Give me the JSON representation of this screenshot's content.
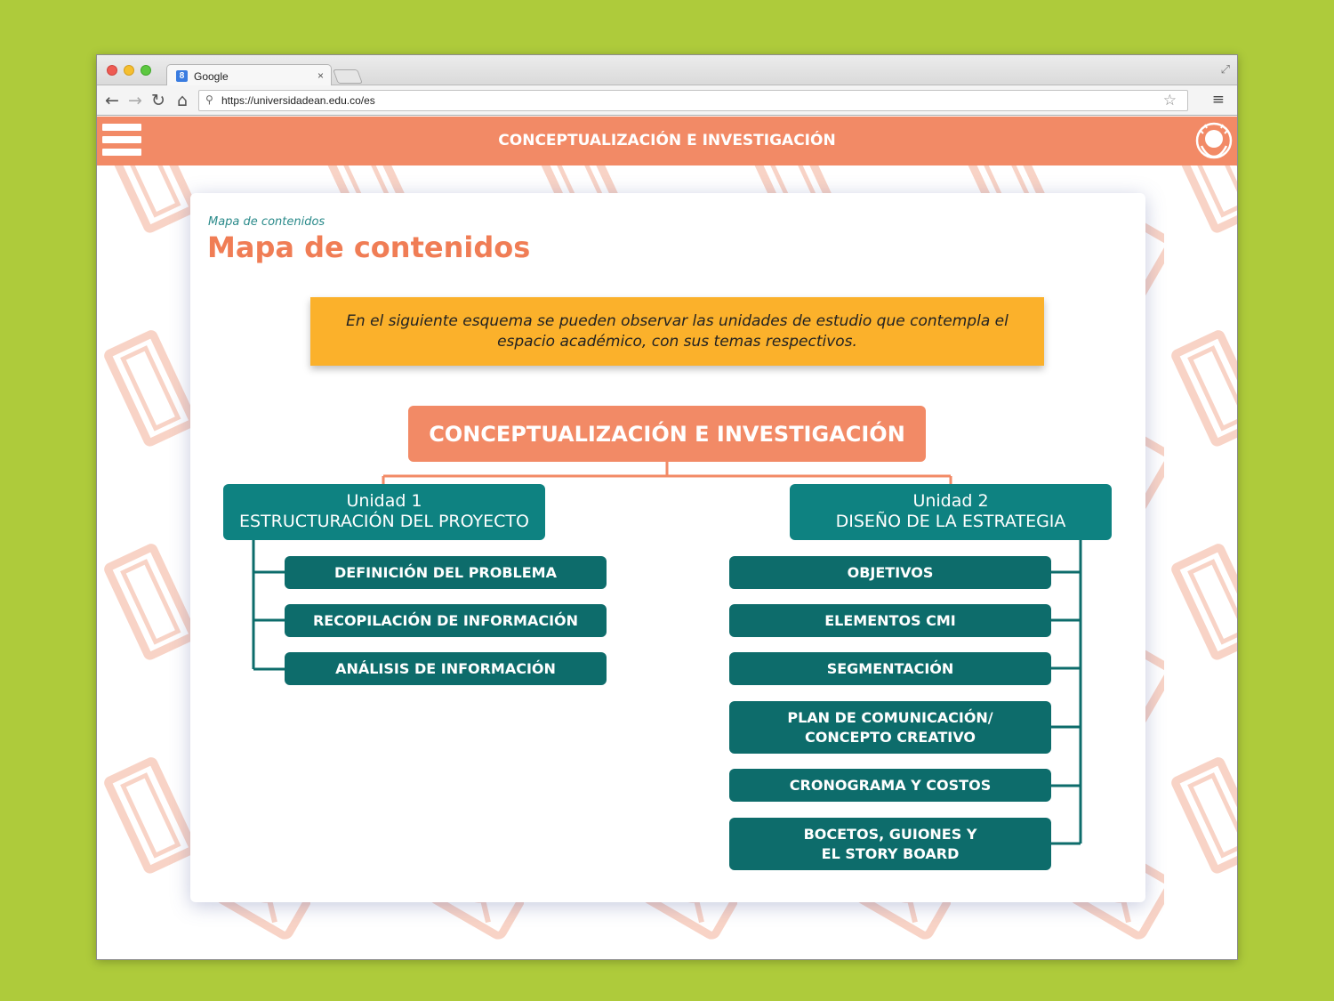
{
  "browser": {
    "tab_title": "Google",
    "tab_close": "×",
    "favicon": "8",
    "url": "https://universidadean.edu.co/es"
  },
  "header": {
    "title": "CONCEPTUALIZACIÓN E INVESTIGACIÓN"
  },
  "content": {
    "breadcrumb": "Mapa de contenidos",
    "page_title": "Mapa de contenidos",
    "intro": "En el siguiente esquema se pueden observar las unidades de estudio que contempla el espacio académico, con sus temas respectivos."
  },
  "map": {
    "root": "CONCEPTUALIZACIÓN E INVESTIGACIÓN",
    "units": [
      {
        "number": "Unidad 1",
        "name": "ESTRUCTURACIÓN DEL PROYECTO",
        "topics": [
          "DEFINICIÓN DEL PROBLEMA",
          "RECOPILACIÓN DE INFORMACIÓN",
          "ANÁLISIS DE INFORMACIÓN"
        ]
      },
      {
        "number": "Unidad 2",
        "name": "DISEÑO DE LA ESTRATEGIA",
        "topics": [
          "OBJETIVOS",
          "ELEMENTOS CMI",
          "SEGMENTACIÓN",
          "PLAN DE COMUNICACIÓN/",
          "CONCEPTO CREATIVO",
          "CRONOGRAMA Y COSTOS",
          "BOCETOS, GUIONES Y",
          "EL STORY BOARD"
        ]
      }
    ]
  },
  "colors": {
    "accent_orange": "#f28a66",
    "title_orange": "#f07d55",
    "intro_yellow": "#fbb12b",
    "unit_teal": "#0e8281",
    "topic_teal": "#0d6c6b",
    "page_background": "#aecb3b"
  },
  "icons": [
    "back-arrow-icon",
    "forward-arrow-icon",
    "reload-icon",
    "home-icon",
    "search-icon",
    "star-icon",
    "menu-icon",
    "hamburger-menu-icon",
    "university-seal-icon"
  ]
}
